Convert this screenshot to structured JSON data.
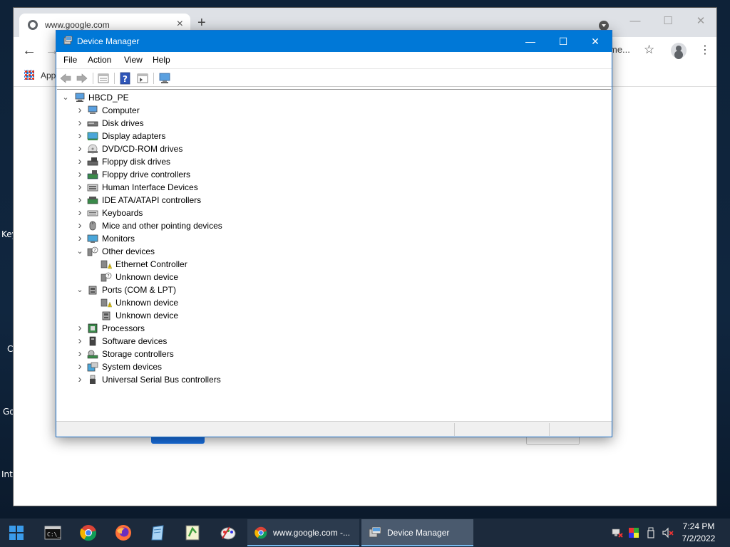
{
  "desktop": {
    "labels": [
      "Key",
      "C",
      "Go",
      "Inte"
    ]
  },
  "chrome": {
    "tab_title": "www.google.com",
    "tab_close": "×",
    "new_tab": "+",
    "win_min": "—",
    "win_max": "☐",
    "win_close": "✕",
    "back": "←",
    "forward": "→",
    "omnibox_tail": "me...",
    "star": "☆",
    "kebab": "⋮",
    "bookmarks_apps": "Apps"
  },
  "devmgr": {
    "title": "Device Manager",
    "min": "—",
    "max": "☐",
    "close": "✕",
    "menu": [
      "File",
      "Action",
      "View",
      "Help"
    ],
    "root": "HBCD_PE",
    "tree": [
      {
        "label": "Computer",
        "level": 1,
        "expander": "collapsed",
        "icon": "computer-icon"
      },
      {
        "label": "Disk drives",
        "level": 1,
        "expander": "collapsed",
        "icon": "disk-drive-icon"
      },
      {
        "label": "Display adapters",
        "level": 1,
        "expander": "collapsed",
        "icon": "display-adapter-icon"
      },
      {
        "label": "DVD/CD-ROM drives",
        "level": 1,
        "expander": "collapsed",
        "icon": "dvd-drive-icon"
      },
      {
        "label": "Floppy disk drives",
        "level": 1,
        "expander": "collapsed",
        "icon": "floppy-drive-icon"
      },
      {
        "label": "Floppy drive controllers",
        "level": 1,
        "expander": "collapsed",
        "icon": "floppy-controller-icon"
      },
      {
        "label": "Human Interface Devices",
        "level": 1,
        "expander": "collapsed",
        "icon": "hid-icon"
      },
      {
        "label": "IDE ATA/ATAPI controllers",
        "level": 1,
        "expander": "collapsed",
        "icon": "ide-controller-icon"
      },
      {
        "label": "Keyboards",
        "level": 1,
        "expander": "collapsed",
        "icon": "keyboard-icon"
      },
      {
        "label": "Mice and other pointing devices",
        "level": 1,
        "expander": "collapsed",
        "icon": "mouse-icon"
      },
      {
        "label": "Monitors",
        "level": 1,
        "expander": "collapsed",
        "icon": "monitor-icon"
      },
      {
        "label": "Other devices",
        "level": 1,
        "expander": "expanded",
        "icon": "other-devices-icon"
      },
      {
        "label": "Ethernet Controller",
        "level": 2,
        "expander": "none",
        "icon": "warning-device-icon"
      },
      {
        "label": "Unknown device",
        "level": 2,
        "expander": "none",
        "icon": "unknown-device-icon"
      },
      {
        "label": "Ports (COM & LPT)",
        "level": 1,
        "expander": "expanded",
        "icon": "port-icon"
      },
      {
        "label": "Unknown device",
        "level": 2,
        "expander": "none",
        "icon": "warning-device-icon"
      },
      {
        "label": "Unknown device",
        "level": 2,
        "expander": "none",
        "icon": "port-icon"
      },
      {
        "label": "Processors",
        "level": 1,
        "expander": "collapsed",
        "icon": "processor-icon"
      },
      {
        "label": "Software devices",
        "level": 1,
        "expander": "collapsed",
        "icon": "software-device-icon"
      },
      {
        "label": "Storage controllers",
        "level": 1,
        "expander": "collapsed",
        "icon": "storage-controller-icon"
      },
      {
        "label": "System devices",
        "level": 1,
        "expander": "collapsed",
        "icon": "system-device-icon"
      },
      {
        "label": "Universal Serial Bus controllers",
        "level": 1,
        "expander": "collapsed",
        "icon": "usb-icon"
      }
    ]
  },
  "taskbar": {
    "pinned": [
      "cmd-icon",
      "chrome-icon",
      "firefox-icon",
      "notepad-icon",
      "notepadpp-icon",
      "paint-icon"
    ],
    "items": [
      {
        "label": "www.google.com -...",
        "icon": "chrome-icon",
        "active": false
      },
      {
        "label": "Device Manager",
        "icon": "device-manager-icon",
        "active": true
      }
    ],
    "time": "7:24 PM",
    "date": "7/2/2022"
  },
  "colors": {
    "titlebar": "#0078d7",
    "taskbar": "#1c2a3c",
    "active_task": "#4a5a6e"
  }
}
